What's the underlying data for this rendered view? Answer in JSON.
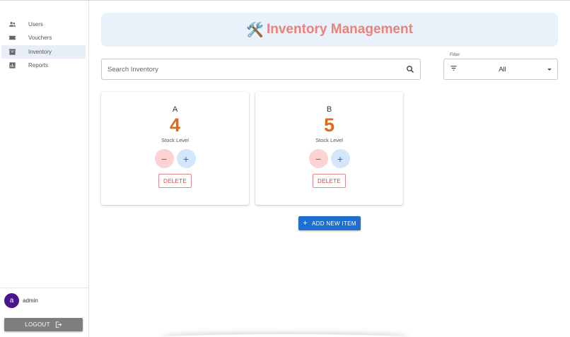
{
  "sidebar": {
    "items": [
      {
        "label": "Users",
        "icon": "users-icon"
      },
      {
        "label": "Vouchers",
        "icon": "ticket-icon"
      },
      {
        "label": "Inventory",
        "icon": "inventory-icon",
        "active": true
      },
      {
        "label": "Reports",
        "icon": "chart-icon"
      }
    ],
    "user": {
      "initial": "a",
      "name": "admin"
    },
    "logout_label": "LOGOUT"
  },
  "header": {
    "emoji": "🛠️",
    "title": "Inventory Management"
  },
  "search": {
    "placeholder": "Search Inventory",
    "value": ""
  },
  "filter": {
    "label": "Filter",
    "value": "All"
  },
  "items": [
    {
      "name": "A",
      "quantity": "4",
      "stock_label": "Stock Level",
      "minus": "−",
      "plus": "+",
      "delete_label": "DELETE"
    },
    {
      "name": "B",
      "quantity": "5",
      "stock_label": "Stock Level",
      "minus": "−",
      "plus": "+",
      "delete_label": "DELETE"
    }
  ],
  "add_button": {
    "plus": "+",
    "label": "ADD NEW ITEM"
  },
  "colors": {
    "accent": "#1f6fd1",
    "title": "#e8837a",
    "quantity": "#e0691c",
    "avatar": "#4a148c"
  }
}
